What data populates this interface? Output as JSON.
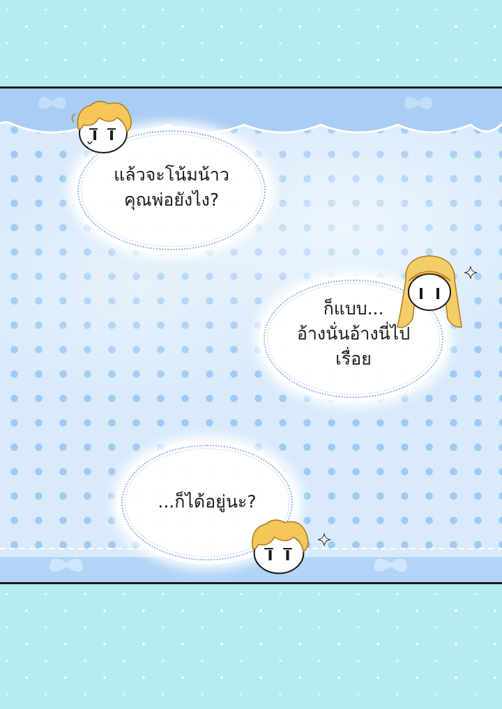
{
  "bubbles": [
    {
      "lines": [
        "แล้วจะโน้มน้าว",
        "คุณพ่อยังไง?"
      ]
    },
    {
      "lines": [
        "ก็แบบ...",
        "อ้างนั่นอ้างนี่ไป",
        "เรื่อย"
      ]
    },
    {
      "lines": [
        "...ก็ได้อยู่นะ?"
      ]
    }
  ],
  "characters": [
    {
      "name": "blond-boy-chibi",
      "hair_color": "#f5c75b"
    },
    {
      "name": "long-haired-girl-chibi",
      "hair_color": "#f3cd6a"
    },
    {
      "name": "blond-boy-chibi-2",
      "hair_color": "#f5c75b"
    }
  ],
  "colors": {
    "background": "#b4ecf2",
    "panel": "#d9ebfb",
    "dots": "#9fcaf3",
    "border": "#1a1a1a"
  }
}
